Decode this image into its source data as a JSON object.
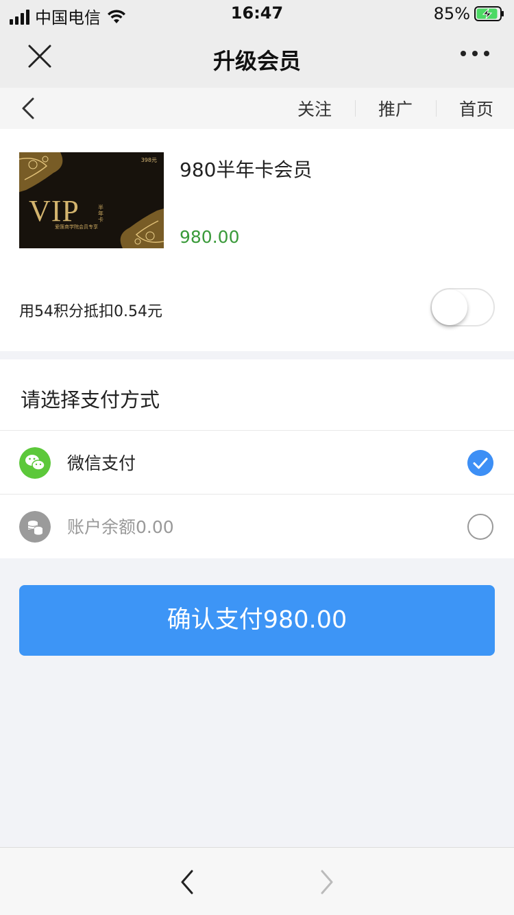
{
  "status_bar": {
    "carrier": "中国电信",
    "time": "16:47",
    "battery": "85%"
  },
  "title_bar": {
    "title": "升级会员"
  },
  "sub_nav": {
    "links": [
      "关注",
      "推广",
      "首页"
    ]
  },
  "product": {
    "card_price": "398元",
    "card_logo_text": "VIP",
    "card_tag": "半年卡",
    "card_subtitle": "爱匯商学院会员专享",
    "title": "980半年卡会员",
    "price": "980.00",
    "price_color": "#3a9a3a"
  },
  "points": {
    "text": "用54积分抵扣0.54元",
    "toggle_on": false
  },
  "payment": {
    "heading": "请选择支付方式",
    "options": [
      {
        "label": "微信支付",
        "icon": "wechat-icon",
        "selected": true,
        "icon_color": "#5cc83a"
      },
      {
        "label": "账户余额0.00",
        "icon": "coins-icon",
        "selected": false,
        "icon_color": "#9b9b9b"
      }
    ]
  },
  "confirm": {
    "label": "确认支付980.00",
    "color": "#3d95f6"
  }
}
